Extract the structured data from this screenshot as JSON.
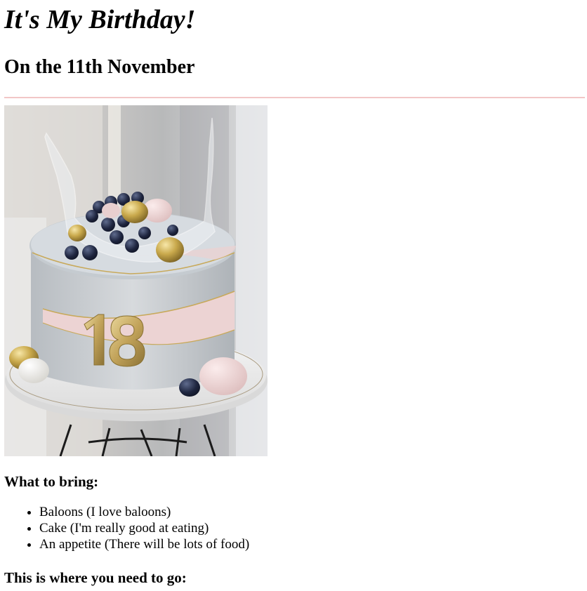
{
  "page": {
    "title": "It's My Birthday!",
    "subtitle": "On the 11th November",
    "divider_color": "#f2c6c6"
  },
  "image": {
    "subject": "birthday-cake-photo",
    "cake_number": "18"
  },
  "bring": {
    "heading": "What to bring:",
    "items": [
      "Baloons (I love baloons)",
      "Cake (I'm really good at eating)",
      "An appetite (There will be lots of food)"
    ]
  },
  "location": {
    "heading": "This is where you need to go:"
  }
}
